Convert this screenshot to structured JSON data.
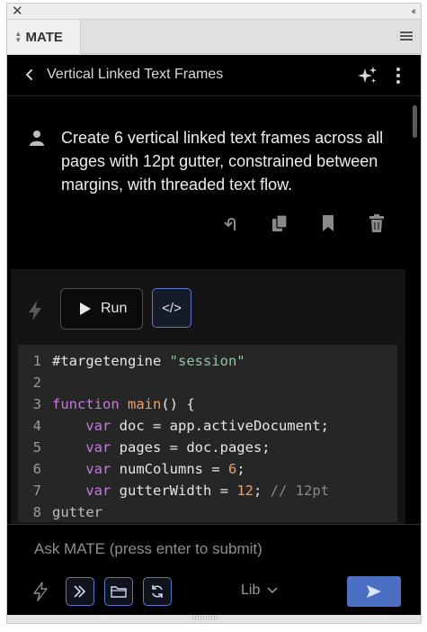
{
  "window": {
    "close_glyph": "✕",
    "collapse_glyph": "‹‹",
    "tab_label": "MATE"
  },
  "header": {
    "title": "Vertical Linked Text Frames"
  },
  "message": {
    "text": "Create 6 vertical linked text frames across all pages with 12pt gutter, constrained between margins, with threaded text flow."
  },
  "run": {
    "run_label": "Run",
    "code_toggle_label": "</>"
  },
  "code": {
    "lines": [
      {
        "n": "1",
        "text": "#targetengine \"session\""
      },
      {
        "n": "2",
        "text": ""
      },
      {
        "n": "3",
        "text": "function main() {"
      },
      {
        "n": "4",
        "text": "    var doc = app.activeDocument;"
      },
      {
        "n": "5",
        "text": "    var pages = doc.pages;"
      },
      {
        "n": "6",
        "text": "    var numColumns = 6;"
      },
      {
        "n": "7",
        "text": "    var gutterWidth = 12; // 12pt"
      },
      {
        "n": "8",
        "text": "gutter"
      }
    ]
  },
  "composer": {
    "placeholder": "Ask MATE (press enter to submit)",
    "lib_label": "Lib"
  },
  "colors": {
    "accent": "#4a6fc3",
    "keyword": "#c678dd",
    "string": "#8fc6a3",
    "number": "#e5a36b"
  }
}
